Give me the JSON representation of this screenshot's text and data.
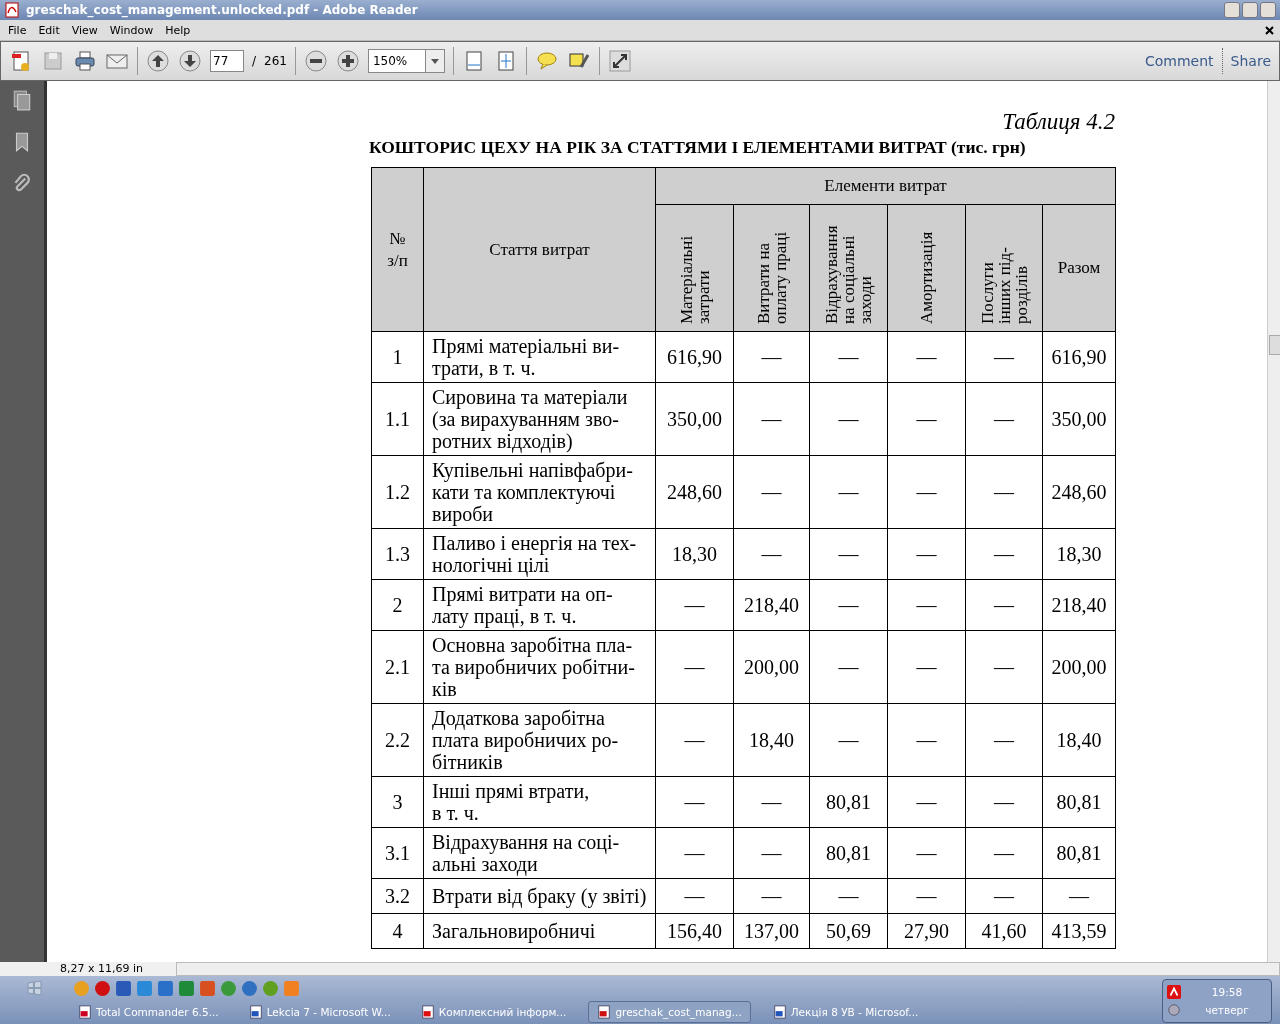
{
  "window": {
    "title": "greschak_cost_management.unlocked.pdf - Adobe Reader"
  },
  "menu": [
    "File",
    "Edit",
    "View",
    "Window",
    "Help"
  ],
  "toolbar": {
    "page": "77",
    "page_sep": "/",
    "page_total": "261",
    "zoom": "150%",
    "links": [
      "Comment",
      "Share"
    ]
  },
  "document": {
    "caption": "Таблиця 4.2",
    "heading": "КОШТОРИС ЦЕХУ НА РІК ЗА СТАТТЯМИ І ЕЛЕМЕНТАМИ ВИТРАТ (тис. грн)",
    "table": {
      "head_no": "№\nз/п",
      "head_item": "Стаття витрат",
      "head_group": "Елементи витрат",
      "columns": [
        {
          "label": "Матеріальні\nзатрати",
          "kind": "vertical"
        },
        {
          "label": "Витрати на\nоплату праці",
          "kind": "vertical"
        },
        {
          "label": "Відрахування\nна соціальні\nзаходи",
          "kind": "vertical"
        },
        {
          "label": "Амортизація",
          "kind": "vertical"
        },
        {
          "label": "Послуги\nінших під-\nрозділів",
          "kind": "vertical"
        },
        {
          "label": "Разом",
          "kind": "horizontal"
        }
      ],
      "rows": [
        {
          "no": "1",
          "item": "Прямі матеріальні ви-\nтрати, в т. ч.",
          "cells": [
            "616,90",
            "—",
            "—",
            "—",
            "—",
            "616,90"
          ]
        },
        {
          "no": "1.1",
          "item": "Сировина та матеріали\n(за вирахуванням зво-\nротних відходів)",
          "cells": [
            "350,00",
            "—",
            "—",
            "—",
            "—",
            "350,00"
          ]
        },
        {
          "no": "1.2",
          "item": "Купівельні напівфабри-\nкати та комплектуючі\nвироби",
          "cells": [
            "248,60",
            "—",
            "—",
            "—",
            "—",
            "248,60"
          ]
        },
        {
          "no": "1.3",
          "item": "Паливо і енергія на тех-\nнологічні цілі",
          "cells": [
            "18,30",
            "—",
            "—",
            "—",
            "—",
            "18,30"
          ]
        },
        {
          "no": "2",
          "item": "Прямі витрати на оп-\nлату праці, в т. ч.",
          "cells": [
            "—",
            "218,40",
            "—",
            "—",
            "—",
            "218,40"
          ]
        },
        {
          "no": "2.1",
          "item": "Основна заробітна пла-\nта виробничих робітни-\nків",
          "cells": [
            "—",
            "200,00",
            "—",
            "—",
            "—",
            "200,00"
          ]
        },
        {
          "no": "2.2",
          "item": "Додаткова заробітна\nплата виробничих ро-\nбітників",
          "cells": [
            "—",
            "18,40",
            "—",
            "—",
            "—",
            "18,40"
          ]
        },
        {
          "no": "3",
          "item": "Інші прямі втрати,\nв т. ч.",
          "cells": [
            "—",
            "—",
            "80,81",
            "—",
            "—",
            "80,81"
          ]
        },
        {
          "no": "3.1",
          "item": "Відрахування на соці-\nальні заходи",
          "cells": [
            "—",
            "—",
            "80,81",
            "—",
            "—",
            "80,81"
          ]
        },
        {
          "no": "3.2",
          "item": "Втрати від браку (у звіті)",
          "cells": [
            "—",
            "—",
            "—",
            "—",
            "—",
            "—"
          ]
        },
        {
          "no": "4",
          "item": "Загальновиробничі",
          "cells": [
            "156,40",
            "137,00",
            "50,69",
            "27,90",
            "41,60",
            "413,59"
          ]
        }
      ]
    }
  },
  "status": {
    "page_size": "8,27 x 11,69 in"
  },
  "taskbar": {
    "tasks": [
      {
        "label": "Total Commander 6.5...",
        "selected": false
      },
      {
        "label": "Lekcia 7 - Microsoft W...",
        "selected": false
      },
      {
        "label": "Комплексний інформ...",
        "selected": false
      },
      {
        "label": "greschak_cost_manag...",
        "selected": true
      },
      {
        "label": "Лекція 8 УВ - Microsof...",
        "selected": false
      }
    ],
    "time": "19:58",
    "day": "четверг"
  }
}
